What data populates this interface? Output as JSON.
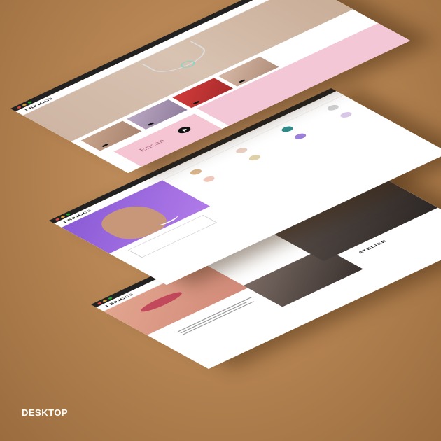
{
  "label": "DESKTOP",
  "brand": "J BRIGGS",
  "layers": {
    "top": {
      "tiles": [
        {
          "caption": ""
        },
        {
          "caption": ""
        },
        {
          "caption": ""
        },
        {
          "caption": ""
        }
      ],
      "promo_title": "Encan"
    },
    "bottom": {
      "section": "ATELIER"
    }
  },
  "colors": {
    "background": "#b88654",
    "pink": "#f4c7d6",
    "purple": "#8a5bd6",
    "dark": "#111111"
  }
}
